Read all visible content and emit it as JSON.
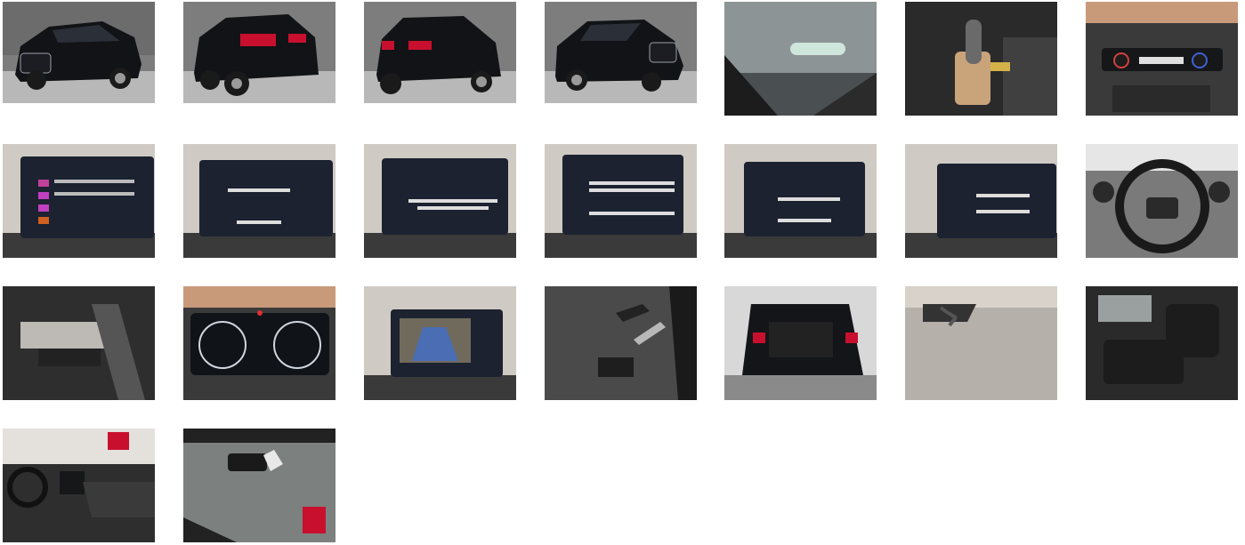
{
  "gallery": {
    "photos": [
      {
        "icon": "car-front-left-photo"
      },
      {
        "icon": "car-rear-left-photo"
      },
      {
        "icon": "car-rear-right-photo"
      },
      {
        "icon": "car-front-right-photo"
      },
      {
        "icon": "windshield-sticker-photo"
      },
      {
        "icon": "gear-shifter-photo"
      },
      {
        "icon": "climate-control-photo"
      },
      {
        "icon": "radio-screen-photo"
      },
      {
        "icon": "phone-connect-screen-photo"
      },
      {
        "icon": "navigation-screen-photo"
      },
      {
        "icon": "bluetooth-screen-photo"
      },
      {
        "icon": "settings-screen-photo"
      },
      {
        "icon": "service-screen-photo"
      },
      {
        "icon": "steering-wheel-photo"
      },
      {
        "icon": "stalk-controls-photo"
      },
      {
        "icon": "instrument-cluster-photo"
      },
      {
        "icon": "reverse-camera-photo"
      },
      {
        "icon": "door-panel-photo"
      },
      {
        "icon": "open-trunk-photo"
      },
      {
        "icon": "tow-bar-photo"
      },
      {
        "icon": "rear-seats-photo"
      },
      {
        "icon": "dashboard-passenger-photo"
      },
      {
        "icon": "windshield-mirror-photo"
      }
    ],
    "colors": {
      "background": "#ffffff",
      "studio_wall": "#8a8a8a",
      "car_body": "#111214",
      "screen": "#1c2230",
      "interior": "#3a3a3a",
      "taillight": "#c8102e"
    }
  }
}
